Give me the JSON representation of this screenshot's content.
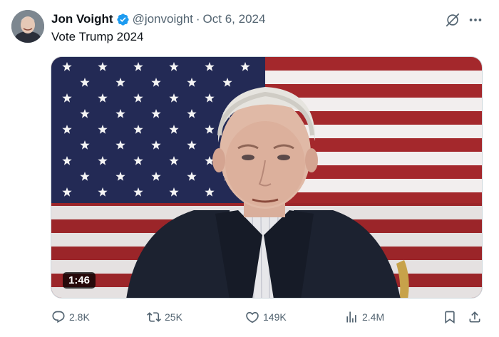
{
  "author": {
    "name": "Jon Voight",
    "handle": "@jonvoight",
    "separator": "·",
    "date": "Oct 6, 2024",
    "verified": true
  },
  "tweet": {
    "text": "Vote Trump 2024"
  },
  "media": {
    "type": "video",
    "duration": "1:46"
  },
  "actions": {
    "replies": "2.8K",
    "reposts": "25K",
    "likes": "149K",
    "views": "2.4M"
  },
  "icons": {
    "verified": "verified-badge-icon",
    "grok": "grok-icon",
    "more": "more-icon",
    "reply": "reply-icon",
    "repost": "repost-icon",
    "like": "heart-icon",
    "views": "views-icon",
    "bookmark": "bookmark-icon",
    "share": "share-icon"
  },
  "colors": {
    "text": "#0f1419",
    "secondary": "#536471",
    "verified": "#1d9bf0",
    "flag_red": "#a4282c",
    "flag_blue": "#232a55"
  }
}
